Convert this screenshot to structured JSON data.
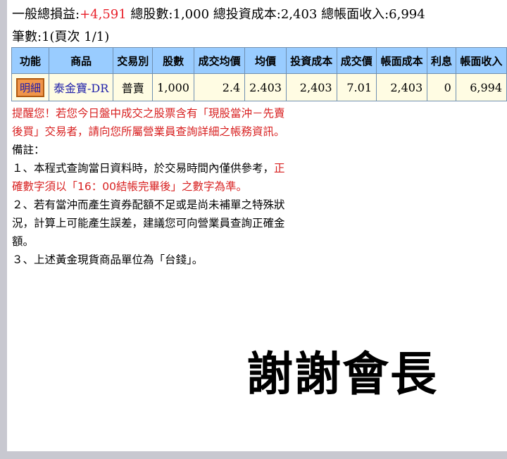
{
  "summary": {
    "profit_label": "一般總損益:",
    "profit_value": "+4,591",
    "shares_label": " 總股數:",
    "shares_value": "1,000",
    "cost_label": " 總投資成本:",
    "cost_value": "2,403",
    "income_label": " 總帳面收入:",
    "income_value": "6,994"
  },
  "record_count": "筆數:1(頁次 1/1)",
  "table": {
    "headers": [
      "功能",
      "商品",
      "交易別",
      "股數",
      "成交均價",
      "均價",
      "投資成本",
      "成交價",
      "帳面成本",
      "利息",
      "帳面收入"
    ],
    "row": {
      "action": "明細",
      "product": "泰金寶-DR",
      "trade_type": "普賣",
      "shares": "1,000",
      "avg_deal_price": "2.4",
      "avg_price": "2.403",
      "invest_cost": "2,403",
      "deal_price": "7.01",
      "book_cost": "2,403",
      "interest": "0",
      "book_income": "6,994"
    }
  },
  "notes": {
    "warning": "提醒您！若您今日盤中成交之股票含有「現股當沖－先賣後買」交易者，請向您所屬營業員查詢詳細之帳務資訊。",
    "remark_title": "備註：",
    "remark1_prefix": "１、本程式查詢當日資料時，於交易時間內僅供參考，",
    "remark1_red": "正確數字須以「16：00結帳完畢後」之數字為準。",
    "remark2": "２、若有當沖而產生資券配額不足或是尚未補單之特殊狀況，計算上可能產生誤差，建議您可向營業員查詢正確金額。",
    "remark3": "３、上述黃金現貨商品單位為「台錢」。"
  },
  "overlay_text": "謝謝會長",
  "colors": {
    "header_bg": "#99ccff",
    "cell_bg": "#fffce3",
    "profit_red": "#e8202a",
    "button_bg": "#f0954a"
  }
}
